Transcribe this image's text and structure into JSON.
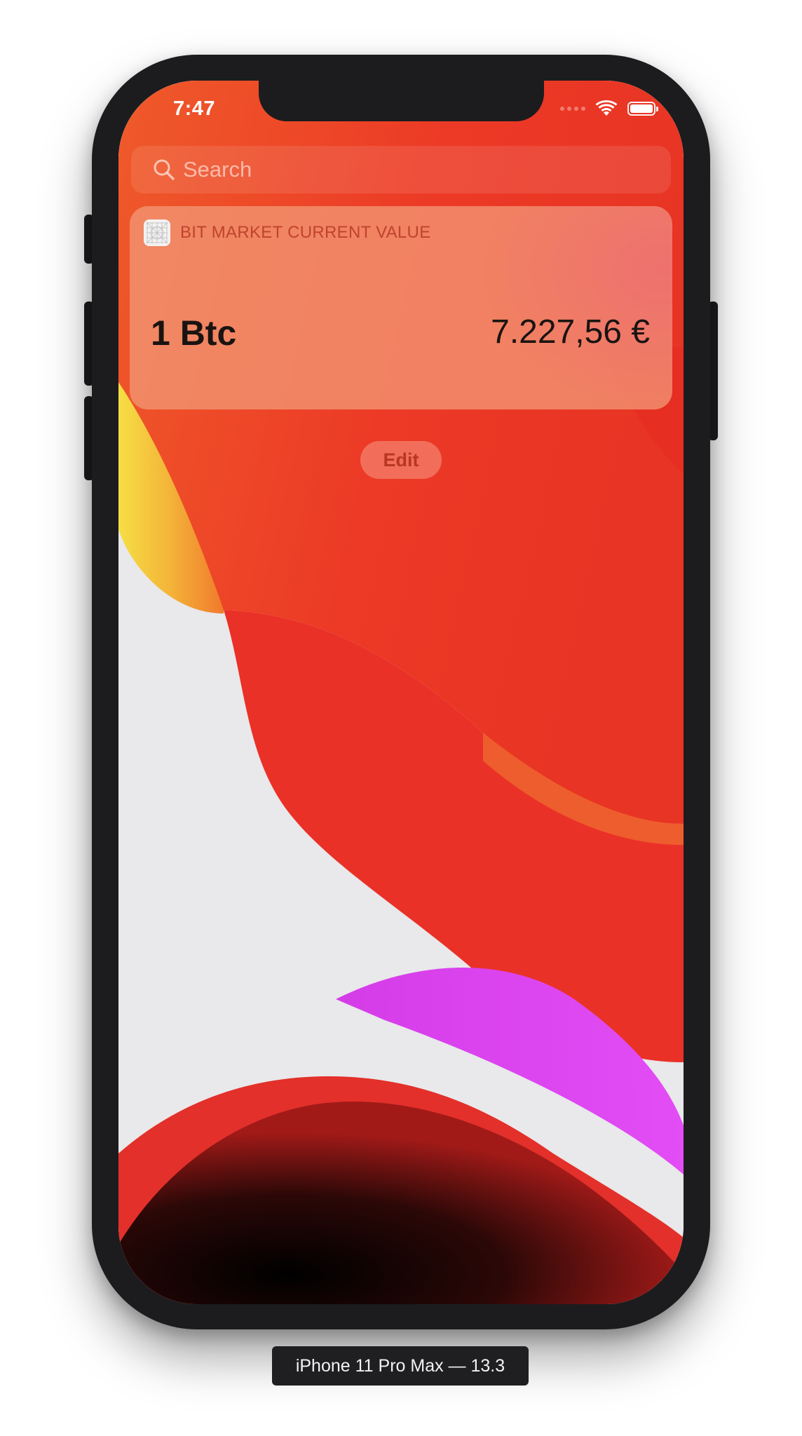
{
  "status_bar": {
    "time": "7:47",
    "icons": [
      "signal-dots-icon",
      "wifi-icon",
      "battery-icon"
    ]
  },
  "search": {
    "placeholder": "Search",
    "value": ""
  },
  "widget": {
    "app_icon": "app-placeholder-icon",
    "title": "BIT MARKET CURRENT VALUE",
    "amount_label": "1 Btc",
    "value_label": "7.227,56 €"
  },
  "edit_button": {
    "label": "Edit"
  },
  "simulator": {
    "device_label": "iPhone 11 Pro Max — 13.3"
  },
  "colors": {
    "wallpaper_red": "#ec3527",
    "wallpaper_orange": "#ef5a2a",
    "wallpaper_yellow": "#f4d63f",
    "wallpaper_magenta": "#d93cf0",
    "widget_title": "#c0432d",
    "edit_text": "#b83722"
  }
}
